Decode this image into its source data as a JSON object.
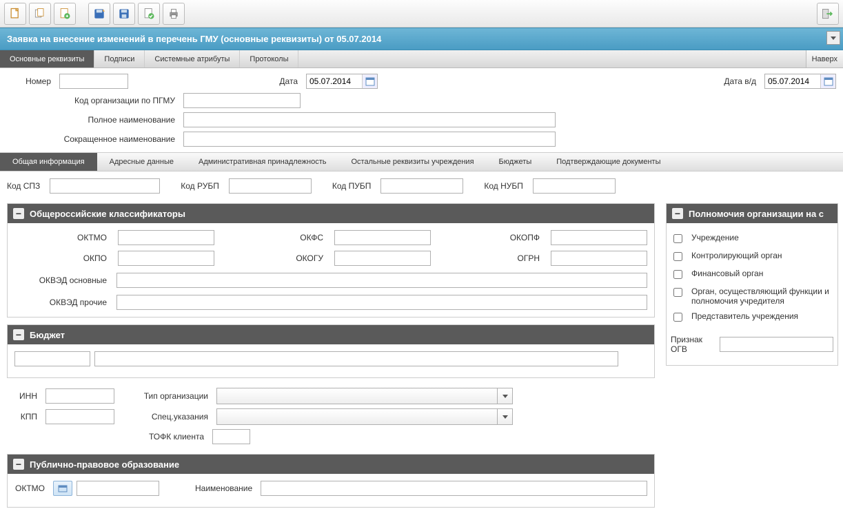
{
  "toolbar_icons": [
    "doc-new",
    "doc-copy",
    "doc-export",
    "disk-star",
    "disk",
    "doc-check",
    "printer",
    "exit"
  ],
  "title": "Заявка на внесение изменений в перечень ГМУ (основные реквизиты) от 05.07.2014",
  "main_tabs": [
    "Основные реквизиты",
    "Подписи",
    "Системные атрибуты",
    "Протоколы"
  ],
  "right_btn": "Наверх",
  "header_form": {
    "number_lbl": "Номер",
    "date_lbl": "Дата",
    "date_val": "05.07.2014",
    "date2_lbl": "Дата в/д",
    "date2_val": "05.07.2014",
    "org_code_lbl": "Код организации по ПГМУ",
    "full_name_lbl": "Полное наименование",
    "short_name_lbl": "Сокращенное наименование"
  },
  "sub_tabs": [
    "Общая информация",
    "Адресные данные",
    "Административная принадлежность",
    "Остальные реквизиты учреждения",
    "Бюджеты",
    "Подтверждающие документы"
  ],
  "codes": {
    "spz": "Код СПЗ",
    "rubp": "Код РУБП",
    "pubp": "Код ПУБП",
    "nubp": "Код НУБП"
  },
  "panels": {
    "classifiers": {
      "title": "Общероссийские классификаторы",
      "oktmo": "ОКТМО",
      "okfs": "ОКФС",
      "okopf": "ОКОПФ",
      "okpo": "ОКПО",
      "okogu": "ОКОГУ",
      "ogrn": "ОГРН",
      "okved_main": "ОКВЭД основные",
      "okved_other": "ОКВЭД прочие"
    },
    "budget": {
      "title": "Бюджет"
    },
    "ppo": {
      "title": "Публично-правовое образование",
      "oktmo": "ОКТМО",
      "name": "Наименование"
    }
  },
  "lower": {
    "inn": "ИНН",
    "kpp": "КПП",
    "orgtype": "Тип организации",
    "spec": "Спец.указания",
    "tofk": "ТОФК клиента"
  },
  "right_panel": {
    "title": "Полномочия организации на с",
    "items": [
      "Учреждение",
      "Контролирующий орган",
      "Финансовый орган",
      "Орган, осуществляющий функции и полномочия учредителя",
      "Представитель учреждения"
    ],
    "ogv_lbl": "Признак ОГВ"
  }
}
